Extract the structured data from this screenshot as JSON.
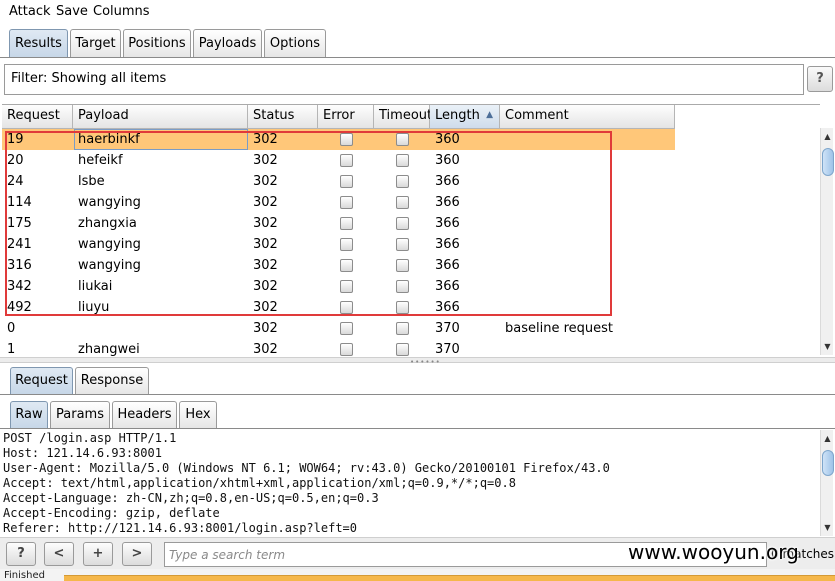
{
  "menu": {
    "items": [
      "Attack",
      "Save",
      "Columns"
    ]
  },
  "top_tabs": [
    "Results",
    "Target",
    "Positions",
    "Payloads",
    "Options"
  ],
  "active_top_tab": "Results",
  "filter": {
    "text": "Filter: Showing all items",
    "help_label": "?"
  },
  "results_table": {
    "columns": [
      "Request",
      "Payload",
      "Status",
      "Error",
      "Timeout",
      "Length",
      "Comment"
    ],
    "sorted_column": "Length",
    "sort_arrow": "▲",
    "rows": [
      {
        "request": "19",
        "payload": "haerbinkf",
        "status": "302",
        "error": false,
        "timeout": false,
        "length": "360",
        "comment": ""
      },
      {
        "request": "20",
        "payload": "hefeikf",
        "status": "302",
        "error": false,
        "timeout": false,
        "length": "360",
        "comment": ""
      },
      {
        "request": "24",
        "payload": "lsbe",
        "status": "302",
        "error": false,
        "timeout": false,
        "length": "366",
        "comment": ""
      },
      {
        "request": "114",
        "payload": "wangying",
        "status": "302",
        "error": false,
        "timeout": false,
        "length": "366",
        "comment": ""
      },
      {
        "request": "175",
        "payload": "zhangxia",
        "status": "302",
        "error": false,
        "timeout": false,
        "length": "366",
        "comment": ""
      },
      {
        "request": "241",
        "payload": "wangying",
        "status": "302",
        "error": false,
        "timeout": false,
        "length": "366",
        "comment": ""
      },
      {
        "request": "316",
        "payload": "wangying",
        "status": "302",
        "error": false,
        "timeout": false,
        "length": "366",
        "comment": ""
      },
      {
        "request": "342",
        "payload": "liukai",
        "status": "302",
        "error": false,
        "timeout": false,
        "length": "366",
        "comment": ""
      },
      {
        "request": "492",
        "payload": "liuyu",
        "status": "302",
        "error": false,
        "timeout": false,
        "length": "366",
        "comment": ""
      },
      {
        "request": "0",
        "payload": "",
        "status": "302",
        "error": false,
        "timeout": false,
        "length": "370",
        "comment": "baseline request"
      },
      {
        "request": "1",
        "payload": "zhangwei",
        "status": "302",
        "error": false,
        "timeout": false,
        "length": "370",
        "comment": ""
      }
    ],
    "selected_row": 0
  },
  "reqresp_tabs": [
    "Request",
    "Response"
  ],
  "active_reqresp_tab": "Request",
  "view_tabs": [
    "Raw",
    "Params",
    "Headers",
    "Hex"
  ],
  "active_view_tab": "Raw",
  "raw_request_lines": [
    "POST /login.asp HTTP/1.1",
    "Host: 121.14.6.93:8001",
    "User-Agent: Mozilla/5.0 (Windows NT 6.1; WOW64; rv:43.0) Gecko/20100101 Firefox/43.0",
    "Accept: text/html,application/xhtml+xml,application/xml;q=0.9,*/*;q=0.8",
    "Accept-Language: zh-CN,zh;q=0.8,en-US;q=0.5,en;q=0.3",
    "Accept-Encoding: gzip, deflate",
    "Referer: http://121.14.6.93:8001/login.asp?left=0"
  ],
  "search_bar": {
    "help_label": "?",
    "prev_label": "<",
    "add_label": "+",
    "next_label": ">",
    "placeholder": "Type a search term",
    "matches_text": "0 matches"
  },
  "status_text": "Finished",
  "progress": 1.0,
  "watermark": "www.wooyun.org",
  "colors": {
    "selected_row": "#ffc779",
    "highlight_box": "#e03a3a",
    "progress": "#f5b74a"
  }
}
